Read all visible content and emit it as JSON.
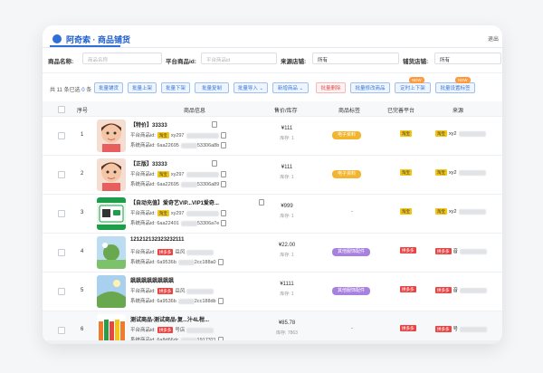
{
  "header": {
    "title": "阿奇索 · 商品铺货",
    "right_text": "退出"
  },
  "filters": [
    {
      "label": "商品名称:",
      "placeholder": "商品名称"
    },
    {
      "label": "平台商品id:",
      "placeholder": "平台商品id"
    },
    {
      "label": "来源店铺:",
      "value": "所有"
    },
    {
      "label": "铺货店铺:",
      "value": "所有"
    }
  ],
  "toolbar": {
    "summary_prefix": "共 11 条已选",
    "summary_count": "0",
    "summary_suffix": "条",
    "buttons": [
      {
        "label": "批量铺货"
      },
      {
        "label": "批量上架"
      },
      {
        "label": "批量下架"
      },
      {
        "label": "批量复制"
      },
      {
        "label": "批量导入 ⌄"
      },
      {
        "label": "新增商品 ⌄"
      },
      {
        "label": "批量删除"
      },
      {
        "label": "批量修改商品"
      },
      {
        "label": "定时上下架"
      },
      {
        "label": "批量设置标签"
      }
    ],
    "new_badge": "NEW"
  },
  "table": {
    "headers": [
      "序号",
      "商品信息",
      "售价/库存",
      "商品标签",
      "已完善平台",
      "来源"
    ],
    "rows": [
      {
        "seq": "1",
        "name": "【特价】33333",
        "line2_label": "平台商品id:",
        "line2_tag": "淘宝",
        "line2_value": "xy297",
        "line3_label": "系统商品id:",
        "line3_value": "6aa22695",
        "line3_tail": "53306a8b",
        "price": "¥111",
        "stock": "库存: 1",
        "category": "电子资料",
        "category_color": "yellow",
        "platform_tag": "淘宝",
        "source_text": "xy2",
        "highlight": false
      },
      {
        "seq": "2",
        "name": "【正版】33333",
        "line2_label": "平台商品id:",
        "line2_tag": "淘宝",
        "line2_value": "xy297",
        "line3_label": "系统商品id:",
        "line3_value": "6aa22695",
        "line3_tail": "53306a89",
        "price": "¥111",
        "stock": "库存: 1",
        "category": "电子资料",
        "category_color": "yellow",
        "platform_tag": "淘宝",
        "source_text": "xy2",
        "highlight": false
      },
      {
        "seq": "3",
        "name": "【自动充值】爱奇艺VIP...VIP1爱奇...",
        "line2_label": "平台商品id:",
        "line2_tag": "淘宝",
        "line2_value": "xy297",
        "line3_label": "系统商品id:",
        "line3_value": "6aa22401",
        "line3_tail": "53306a7e",
        "price": "¥999",
        "stock": "库存: 1",
        "category": "-",
        "category_color": "none",
        "platform_tag": "淘宝",
        "source_text": "xy2",
        "highlight": false
      },
      {
        "seq": "4",
        "name": "121212132323232111",
        "line2_label": "平台商品id:",
        "line2_tag": "拼多多",
        "line2_value": "岳风",
        "line3_label": "系统商品id:",
        "line3_value": "6a9536b",
        "line3_tail": "2cc188a0",
        "price": "¥22.00",
        "stock": "库存: 1",
        "category": "其他服饰配件",
        "category_color": "purple",
        "platform_tag": "拼多多",
        "source_text": "音",
        "highlight": false
      },
      {
        "seq": "5",
        "name": "飒飒飒飒飒飒飒飒",
        "line2_label": "平台商品id:",
        "line2_tag": "拼多多",
        "line2_value": "岳风",
        "line3_label": "系统商品id:",
        "line3_value": "6a9536b",
        "line3_tail": "2cc188db",
        "price": "¥1111",
        "stock": "库存: 1",
        "category": "其他服饰配件",
        "category_color": "purple",
        "platform_tag": "拼多多",
        "source_text": "音",
        "highlight": false
      },
      {
        "seq": "6",
        "name": "测试商品-测试商品-复...汁4L柑...",
        "line2_label": "平台商品id:",
        "line2_tag": "拼多多",
        "line2_value": "号店",
        "line3_label": "系统商品id:",
        "line3_value": "6a8d66dc",
        "line3_tail": "1917321",
        "price": "¥85.78",
        "stock": "库存: 7863",
        "category": "-",
        "category_color": "none",
        "platform_tag": "拼多多",
        "source_text": "号",
        "highlight": true
      }
    ]
  },
  "colors": {
    "accent": "#2f6fd6",
    "tag_yellow": "#f0c419",
    "tag_red": "#e84545",
    "cat_yellow": "#f3b52d",
    "cat_purple": "#a880e0"
  }
}
